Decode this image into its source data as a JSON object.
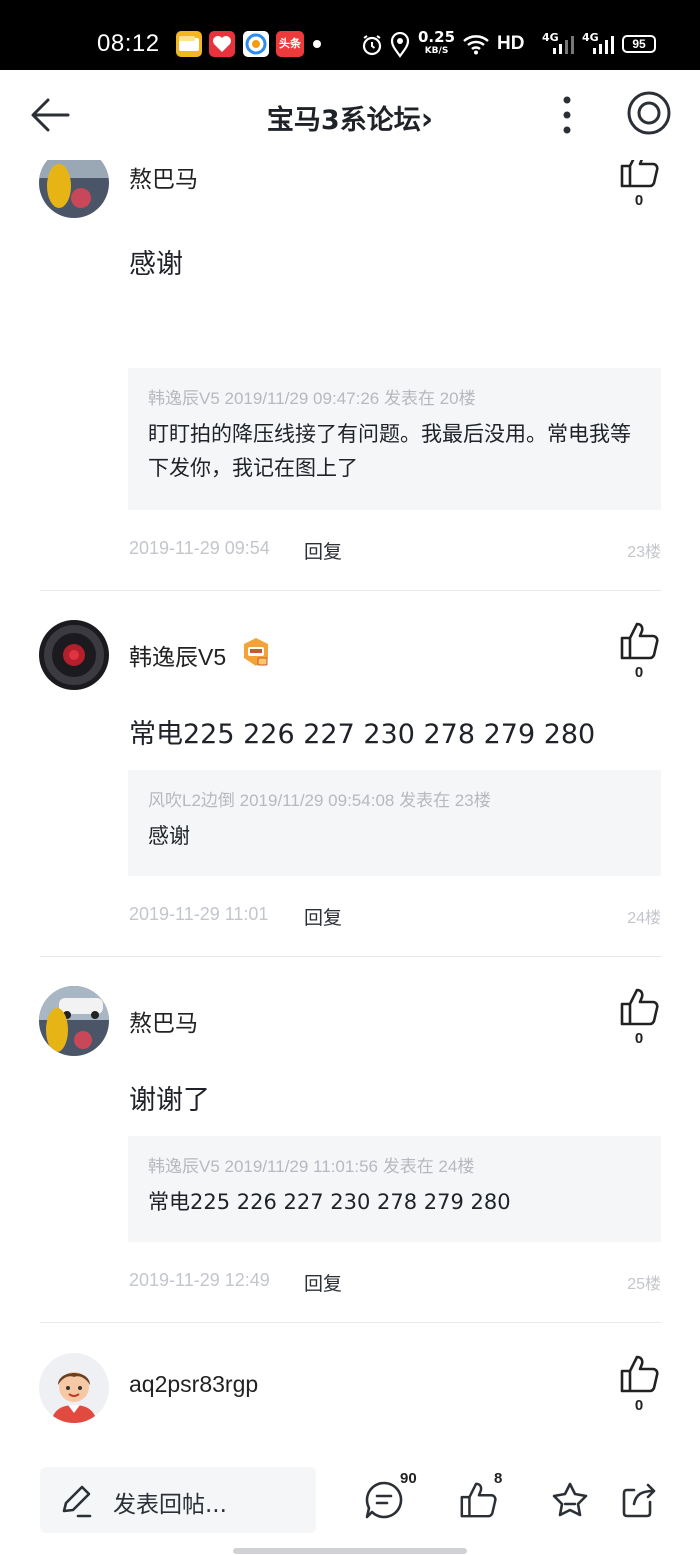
{
  "status_bar": {
    "time": "08:12",
    "app_icons": [
      "wallet-app",
      "health-app",
      "camera-app",
      "toutiao-app"
    ],
    "toutiao_label": "头条",
    "net_speed": "0.25",
    "net_unit": "KB/S",
    "hd_label": "HD",
    "network_1": "4G",
    "network_2": "4G",
    "battery": "95"
  },
  "nav": {
    "title": "宝马3系论坛",
    "title_chevron": "›"
  },
  "posts": [
    {
      "username": "熬巴马",
      "likes": "0",
      "text": "感谢",
      "quote_meta": "韩逸辰V5 2019/11/29 09:47:26 发表在 20楼",
      "quote_text": "盯盯拍的降压线接了有问题。我最后没用。常电我等下发你，我记在图上了",
      "date": "2019-11-29 09:54",
      "reply": "回复",
      "floor": "23楼"
    },
    {
      "username": "韩逸辰V5",
      "likes": "0",
      "text": "常电225 226 227 230 278 279 280",
      "quote_meta": "风吹L2边倒 2019/11/29 09:54:08 发表在 23楼",
      "quote_text": "感谢",
      "date": "2019-11-29 11:01",
      "reply": "回复",
      "floor": "24楼"
    },
    {
      "username": "熬巴马",
      "likes": "0",
      "text": "谢谢了",
      "quote_meta": "韩逸辰V5 2019/11/29 11:01:56 发表在 24楼",
      "quote_text": "常电225 226 227 230 278 279 280",
      "date": "2019-11-29 12:49",
      "reply": "回复",
      "floor": "25楼"
    },
    {
      "username": "aq2psr83rgp",
      "likes": "0"
    }
  ],
  "bottom_bar": {
    "reply_placeholder": "发表回帖...",
    "comment_count": "90",
    "like_count": "8"
  },
  "colors": {
    "accent_text": "#1f2329",
    "muted": "#c3c6cc",
    "quote_bg": "#f5f6f8"
  }
}
